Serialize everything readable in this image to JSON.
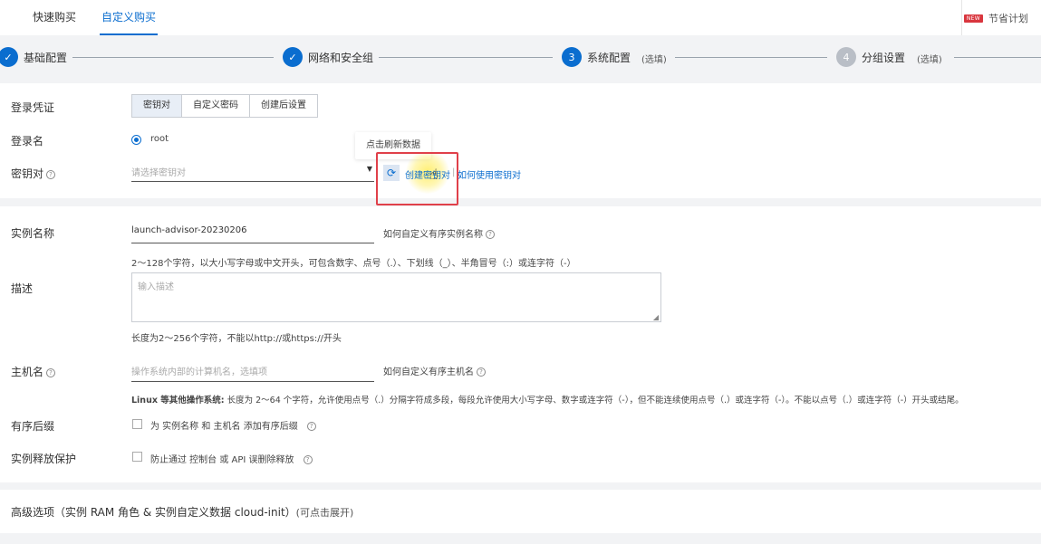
{
  "tabs": [
    {
      "label": "快速购买"
    },
    {
      "label": "自定义购买"
    }
  ],
  "plan": {
    "badge": "NEW",
    "label": "节省计划"
  },
  "steps": [
    {
      "index": "✓",
      "label": "基础配置",
      "optional": ""
    },
    {
      "index": "✓",
      "label": "网络和安全组",
      "optional": ""
    },
    {
      "index": "3",
      "label": "系统配置",
      "optional": "(选填)"
    },
    {
      "index": "4",
      "label": "分组设置",
      "optional": "(选填)"
    }
  ],
  "login": {
    "credential_label": "登录凭证",
    "options": [
      "密钥对",
      "自定义密码",
      "创建后设置"
    ],
    "username_label": "登录名",
    "username_value": "root",
    "keypair_label": "密钥对",
    "keypair_placeholder": "请选择密钥对",
    "refresh_tooltip": "点击刷新数据",
    "create_keypair": "创建密钥对",
    "how_to_keypair": "如何使用密钥对"
  },
  "instance": {
    "name_label": "实例名称",
    "name_value": "launch-advisor-20230206",
    "name_help": "如何自定义有序实例名称",
    "name_hint": "2～128个字符，以大小写字母或中文开头，可包含数字、点号（.）、下划线（_）、半角冒号（:）或连字符（-）",
    "desc_label": "描述",
    "desc_placeholder": "输入描述",
    "desc_hint": "长度为2～256个字符，不能以http://或https://开头",
    "host_label": "主机名",
    "host_placeholder": "操作系统内部的计算机名，选填项",
    "host_help": "如何自定义有序主机名",
    "host_hint_bold": "Linux 等其他操作系统:",
    "host_hint": " 长度为 2～64 个字符，允许使用点号（.）分隔字符成多段，每段允许使用大小写字母、数字或连字符（-），但不能连续使用点号（.）或连字符（-）。不能以点号（.）或连字符（-）开头或结尾。",
    "suffix_label": "有序后缀",
    "suffix_text": "为 实例名称 和 主机名 添加有序后缀",
    "protect_label": "实例释放保护",
    "protect_text": "防止通过 控制台 或 API 误删除释放"
  },
  "advanced": {
    "label": "高级选项（实例 RAM 角色 & 实例自定义数据 cloud-init）",
    "hint": "(可点击展开)"
  },
  "colors": {
    "accent": "#0a6dcf",
    "highlight_box": "#e0404a"
  }
}
